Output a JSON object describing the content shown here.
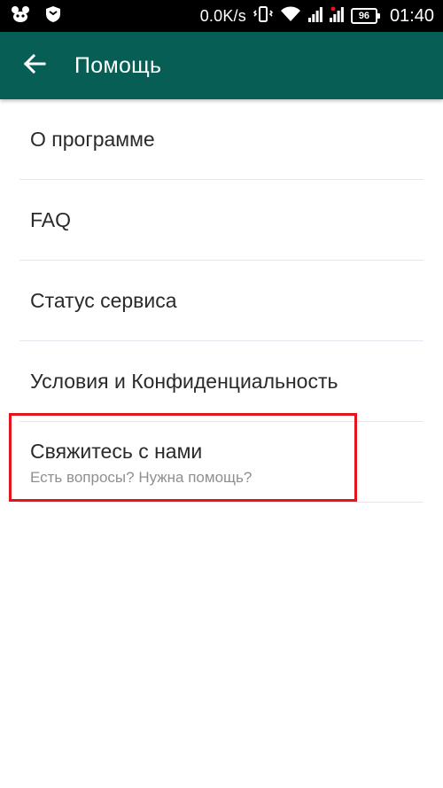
{
  "status_bar": {
    "net_speed": "0.0K/s",
    "battery_level": "96",
    "time": "01:40",
    "left_icons": [
      "notification-app-icon",
      "shield-icon"
    ],
    "right_icons": [
      "vibrate-icon",
      "wifi-icon",
      "signal-icon",
      "signal-icon",
      "battery-icon"
    ]
  },
  "app_bar": {
    "title": "Помощь",
    "color": "#075e54",
    "back_icon": "back-arrow-icon"
  },
  "menu": {
    "items": [
      {
        "label": "О программе"
      },
      {
        "label": "FAQ"
      },
      {
        "label": "Статус сервиса"
      },
      {
        "label": "Условия и Конфиденциальность"
      },
      {
        "label": "Свяжитесь с нами",
        "sublabel": "Есть вопросы? Нужна помощь?"
      }
    ]
  },
  "highlight": {
    "color": "#e3141b",
    "target": "Свяжитесь с нами"
  }
}
